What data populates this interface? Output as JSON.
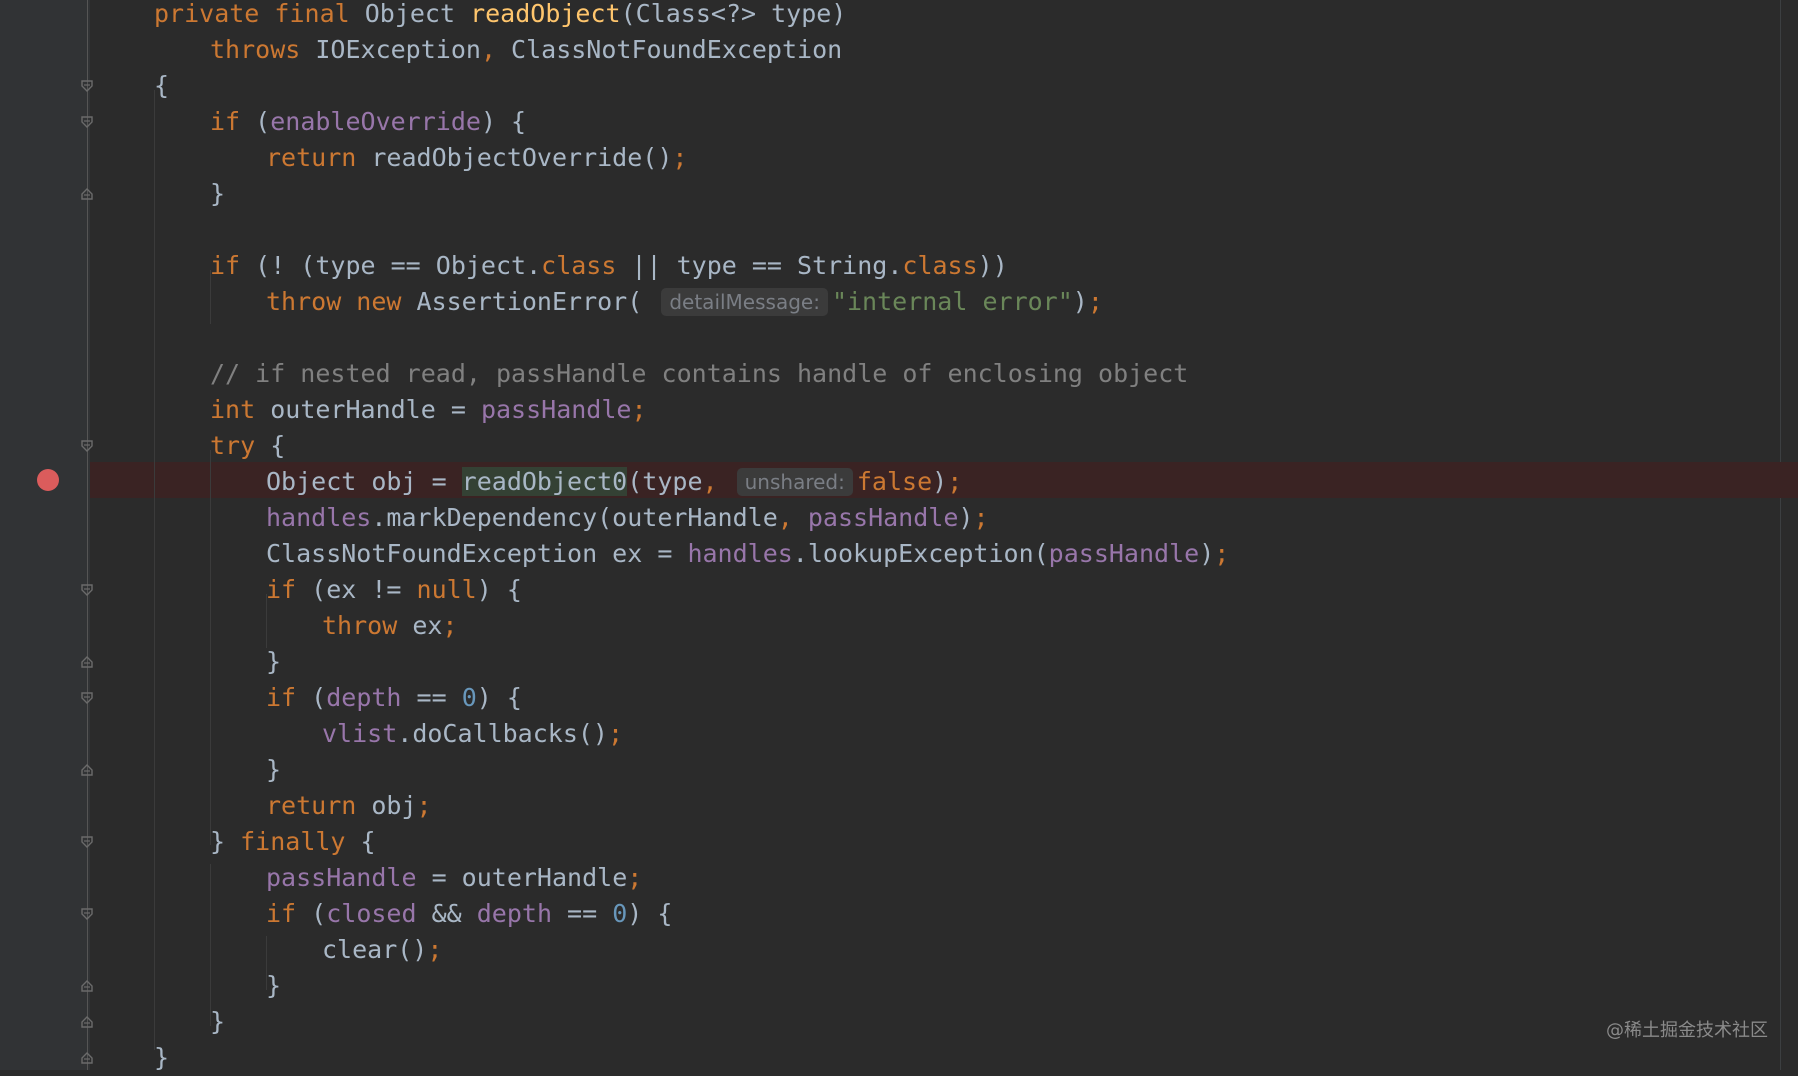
{
  "editor": {
    "language": "java",
    "lines": [
      [
        [
          "kw",
          "private final "
        ],
        [
          "plain",
          "Object "
        ],
        [
          "fn",
          "readObject"
        ],
        [
          "plain",
          "(Class<?> type)"
        ]
      ],
      [
        [
          "kw",
          "throws "
        ],
        [
          "plain",
          "IOException"
        ],
        [
          "kw",
          ", "
        ],
        [
          "plain",
          "ClassNotFoundException"
        ]
      ],
      [
        [
          "plain",
          "{"
        ]
      ],
      [
        [
          "kw",
          "if "
        ],
        [
          "plain",
          "("
        ],
        [
          "fld",
          "enableOverride"
        ],
        [
          "plain",
          ") {"
        ]
      ],
      [
        [
          "kw",
          "return "
        ],
        [
          "plain",
          "readObjectOverride()"
        ],
        [
          "kw",
          ";"
        ]
      ],
      [
        [
          "plain",
          "}"
        ]
      ],
      [],
      [
        [
          "kw",
          "if "
        ],
        [
          "plain",
          "(! (type == Object."
        ],
        [
          "kw",
          "class "
        ],
        [
          "plain",
          "|| type == String."
        ],
        [
          "kw",
          "class"
        ],
        [
          "plain",
          "))"
        ]
      ],
      [
        [
          "kw",
          "throw new "
        ],
        [
          "plain",
          "AssertionError( "
        ],
        [
          "hint",
          "detailMessage:"
        ],
        [
          "str",
          "\"internal error\""
        ],
        [
          "plain",
          ")"
        ],
        [
          "kw",
          ";"
        ]
      ],
      [],
      [
        [
          "cmt",
          "// if nested read, passHandle contains handle of enclosing object"
        ]
      ],
      [
        [
          "kw",
          "int "
        ],
        [
          "plain",
          "outerHandle = "
        ],
        [
          "fld",
          "passHandle"
        ],
        [
          "kw",
          ";"
        ]
      ],
      [
        [
          "kw",
          "try "
        ],
        [
          "plain",
          "{"
        ]
      ],
      [
        [
          "plain",
          "Object obj = "
        ],
        [
          "hl",
          "readObject0"
        ],
        [
          "plain",
          "(type"
        ],
        [
          "kw",
          ", "
        ],
        [
          "hint",
          "unshared:"
        ],
        [
          "kw",
          "false"
        ],
        [
          "plain",
          ")"
        ],
        [
          "kw",
          ";"
        ]
      ],
      [
        [
          "fld",
          "handles"
        ],
        [
          "plain",
          ".markDependency(outerHandle"
        ],
        [
          "kw",
          ", "
        ],
        [
          "fld",
          "passHandle"
        ],
        [
          "plain",
          ")"
        ],
        [
          "kw",
          ";"
        ]
      ],
      [
        [
          "plain",
          "ClassNotFoundException ex = "
        ],
        [
          "fld",
          "handles"
        ],
        [
          "plain",
          ".lookupException("
        ],
        [
          "fld",
          "passHandle"
        ],
        [
          "plain",
          ")"
        ],
        [
          "kw",
          ";"
        ]
      ],
      [
        [
          "kw",
          "if "
        ],
        [
          "plain",
          "(ex != "
        ],
        [
          "kw",
          "null"
        ],
        [
          "plain",
          ") {"
        ]
      ],
      [
        [
          "kw",
          "throw "
        ],
        [
          "plain",
          "ex"
        ],
        [
          "kw",
          ";"
        ]
      ],
      [
        [
          "plain",
          "}"
        ]
      ],
      [
        [
          "kw",
          "if "
        ],
        [
          "plain",
          "("
        ],
        [
          "fld",
          "depth "
        ],
        [
          "plain",
          "== "
        ],
        [
          "num",
          "0"
        ],
        [
          "plain",
          ") {"
        ]
      ],
      [
        [
          "fld",
          "vlist"
        ],
        [
          "plain",
          ".doCallbacks()"
        ],
        [
          "kw",
          ";"
        ]
      ],
      [
        [
          "plain",
          "}"
        ]
      ],
      [
        [
          "kw",
          "return "
        ],
        [
          "plain",
          "obj"
        ],
        [
          "kw",
          ";"
        ]
      ],
      [
        [
          "plain",
          "} "
        ],
        [
          "kw",
          "finally "
        ],
        [
          "plain",
          "{"
        ]
      ],
      [
        [
          "fld",
          "passHandle "
        ],
        [
          "plain",
          "= outerHandle"
        ],
        [
          "kw",
          ";"
        ]
      ],
      [
        [
          "kw",
          "if "
        ],
        [
          "plain",
          "("
        ],
        [
          "fld",
          "closed "
        ],
        [
          "plain",
          "&& "
        ],
        [
          "fld",
          "depth "
        ],
        [
          "plain",
          "== "
        ],
        [
          "num",
          "0"
        ],
        [
          "plain",
          ") {"
        ]
      ],
      [
        [
          "plain",
          "clear()"
        ],
        [
          "kw",
          ";"
        ]
      ],
      [
        [
          "plain",
          "}"
        ]
      ],
      [
        [
          "plain",
          "}"
        ]
      ],
      [
        [
          "plain",
          "}"
        ]
      ]
    ],
    "breakpoint_line": 14
  },
  "watermark": "@稀土掘金技术社区"
}
